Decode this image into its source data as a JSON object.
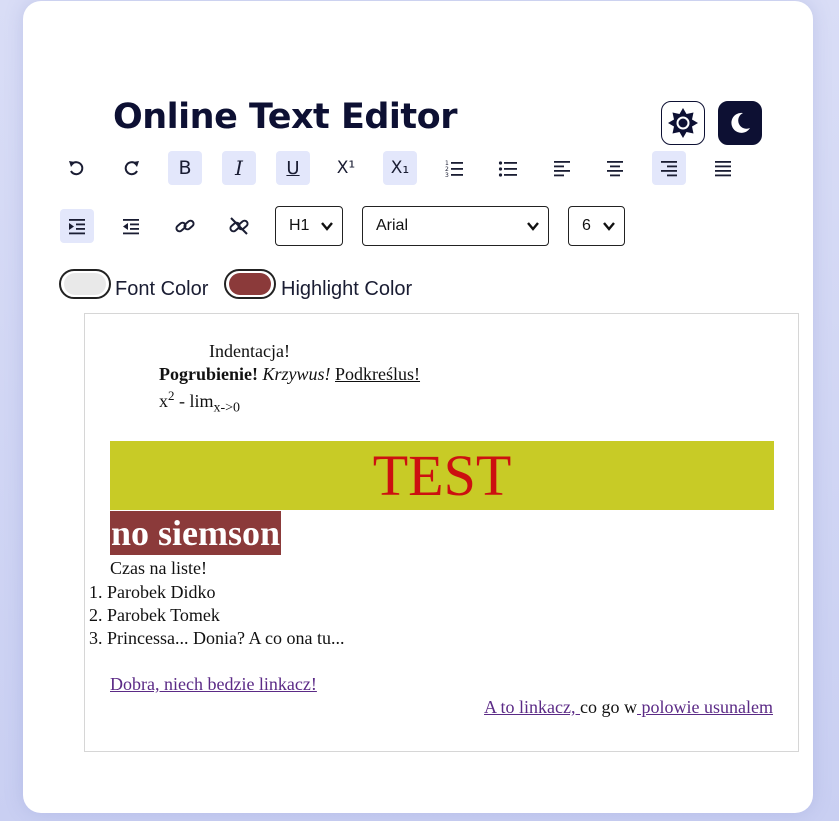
{
  "app": {
    "title": "Online Text Editor"
  },
  "mode_buttons": [
    {
      "name": "light-mode",
      "icon": "sun-icon"
    },
    {
      "name": "dark-mode",
      "icon": "moon-icon"
    }
  ],
  "toolbar": {
    "row1": [
      {
        "name": "undo",
        "icon": "undo-icon",
        "active": false
      },
      {
        "name": "redo",
        "icon": "redo-icon",
        "active": false
      },
      {
        "name": "bold",
        "icon": "bold-icon",
        "glyph": "B",
        "active": true
      },
      {
        "name": "italic",
        "icon": "italic-icon",
        "glyph": "I",
        "active": true
      },
      {
        "name": "underline",
        "icon": "underline-icon",
        "glyph": "U",
        "active": true
      },
      {
        "name": "superscript",
        "icon": "superscript-icon",
        "glyph": "X¹",
        "active": false
      },
      {
        "name": "subscript",
        "icon": "subscript-icon",
        "glyph": "X₁",
        "active": true
      },
      {
        "name": "ordered-list",
        "icon": "ordered-list-icon",
        "active": false
      },
      {
        "name": "unordered-list",
        "icon": "unordered-list-icon",
        "active": false
      },
      {
        "name": "align-left",
        "icon": "align-left-icon",
        "active": false
      },
      {
        "name": "align-center",
        "icon": "align-center-icon",
        "active": false
      },
      {
        "name": "align-right",
        "icon": "align-right-icon",
        "active": true
      },
      {
        "name": "justify",
        "icon": "justify-icon",
        "active": false
      }
    ],
    "row2": [
      {
        "name": "indent",
        "icon": "indent-icon",
        "active": true
      },
      {
        "name": "outdent",
        "icon": "outdent-icon",
        "active": false
      },
      {
        "name": "link",
        "icon": "link-icon",
        "active": false
      },
      {
        "name": "unlink",
        "icon": "unlink-icon",
        "active": false
      }
    ],
    "heading_select": {
      "value": "H1"
    },
    "font_select": {
      "value": "Arial"
    },
    "size_select": {
      "value": "6"
    },
    "font_color": {
      "label": "Font Color",
      "value": "#e9e9e9"
    },
    "highlight_color": {
      "label": "Highlight Color",
      "value": "#8b3a3a"
    }
  },
  "content": {
    "indent_line": "Indentacja!",
    "bold_text": "Pogrubienie!",
    "italic_text": "Krzywus!",
    "underline_text": "Podkreślus!",
    "formula_base": "x",
    "formula_sup": "2",
    "formula_mid": " - lim",
    "formula_sub": "x->0",
    "test_heading": "TEST",
    "test_bg": "#c8cb26",
    "test_color": "#cc1010",
    "highlighted_heading": "no siemson",
    "list_intro": "Czas na liste!",
    "list_items": [
      "Parobek Didko",
      "Parobek Tomek",
      "Princessa... Donia? A co ona tu..."
    ],
    "link1": "Dobra, niech bedzie linkacz!",
    "link2": "A to linkacz, ",
    "middle_text": "co go w",
    "link3": " polowie usunalem"
  }
}
